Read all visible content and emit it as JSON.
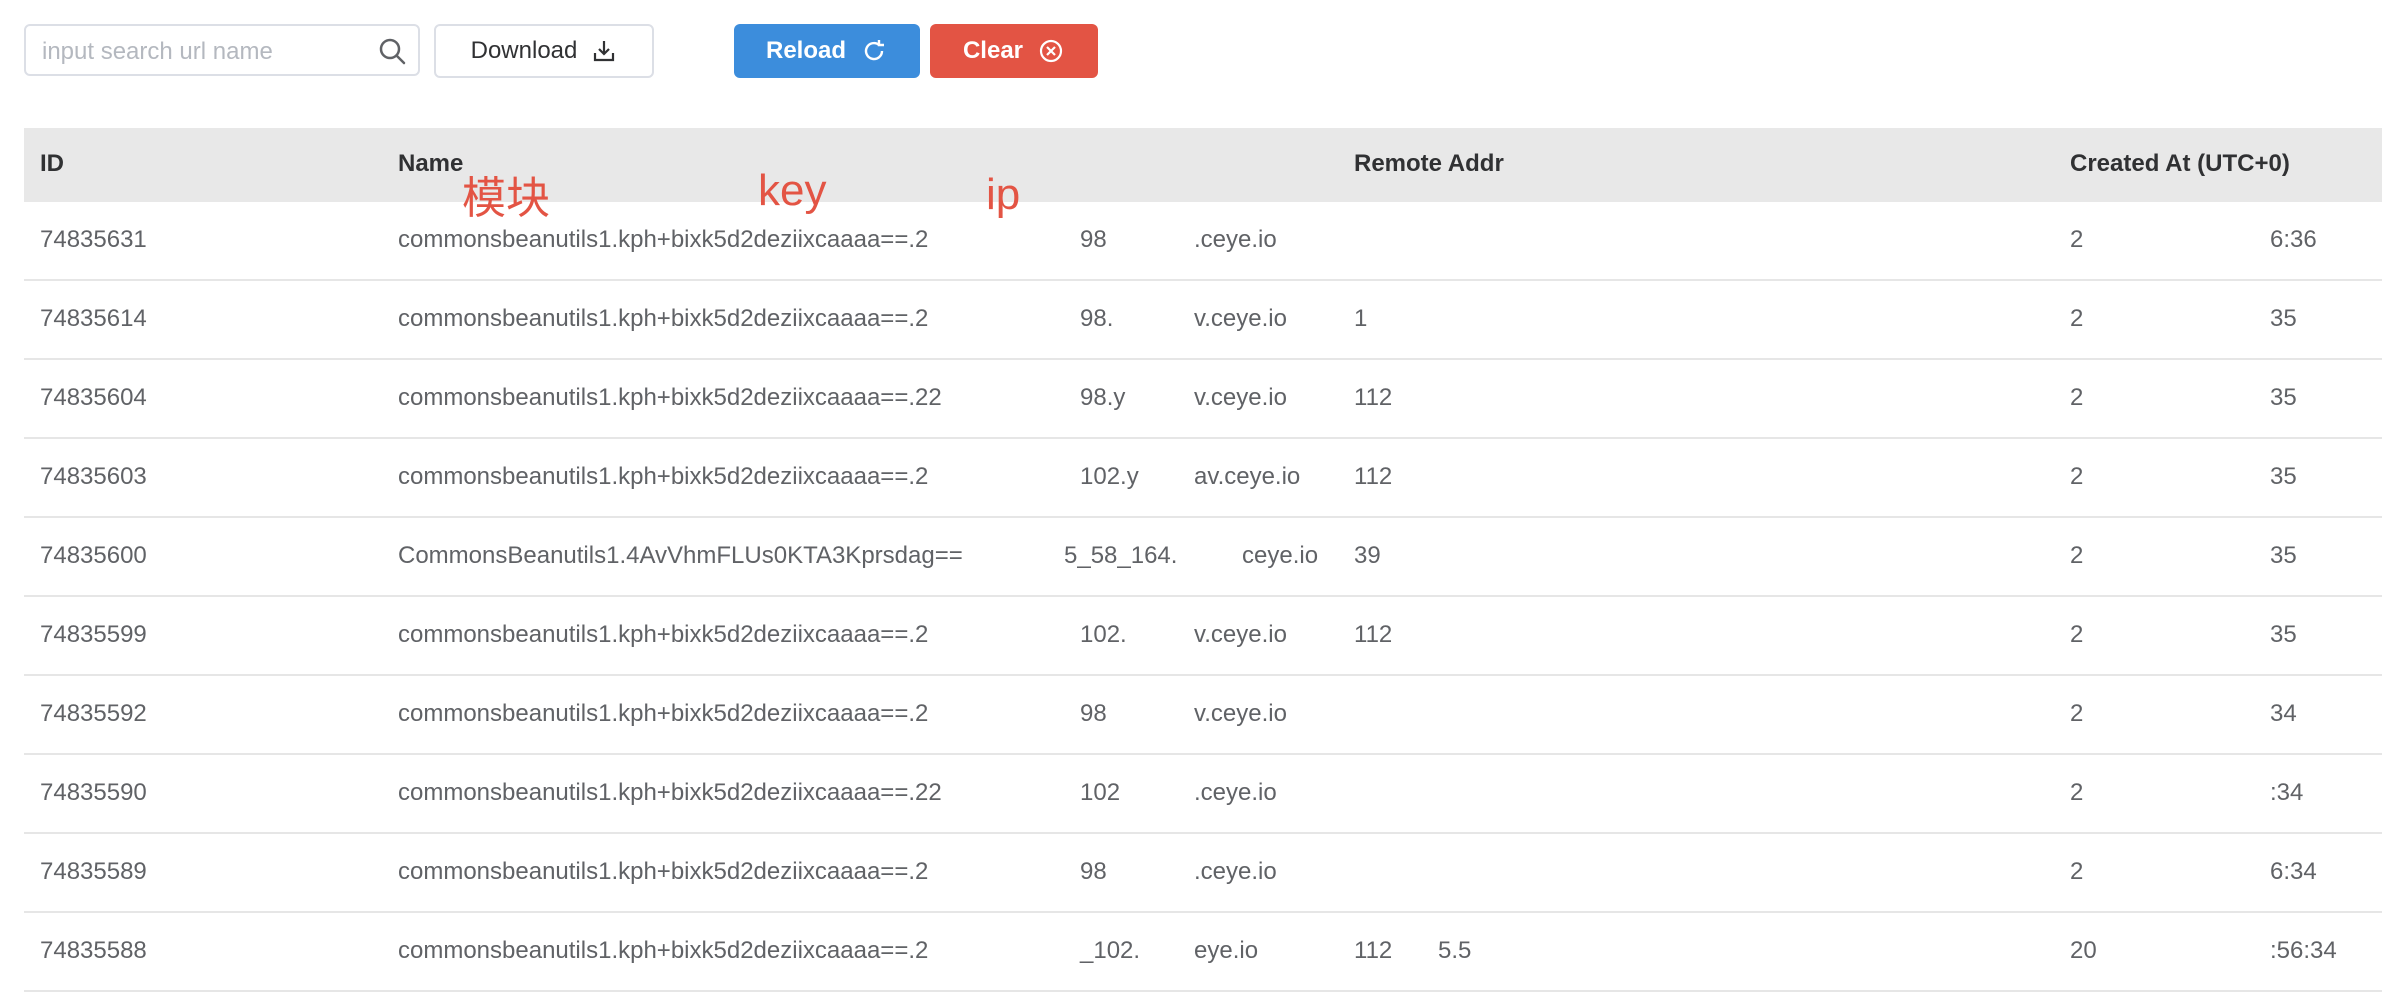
{
  "toolbar": {
    "search_placeholder": "input search url name",
    "download_label": "Download",
    "reload_label": "Reload",
    "clear_label": "Clear"
  },
  "table": {
    "headers": {
      "id": "ID",
      "name": "Name",
      "remote_addr": "Remote Addr",
      "created_at": "Created At (UTC+0)"
    },
    "rows": [
      {
        "id": "74835631",
        "name": "commonsbeanutils1.kph+bixk5d2deziixcaaaa==.2",
        "name_tail": "98",
        "name_suffix": ".ceye.io",
        "addr": "",
        "created": "2",
        "created_tail": "6:36"
      },
      {
        "id": "74835614",
        "name": "commonsbeanutils1.kph+bixk5d2deziixcaaaa==.2",
        "name_tail": "98.",
        "name_suffix": "v.ceye.io",
        "addr": "1",
        "created": "2",
        "created_tail": "35"
      },
      {
        "id": "74835604",
        "name": "commonsbeanutils1.kph+bixk5d2deziixcaaaa==.22",
        "name_tail": "98.y",
        "name_suffix": "v.ceye.io",
        "addr": "112",
        "created": "2",
        "created_tail": "35"
      },
      {
        "id": "74835603",
        "name": "commonsbeanutils1.kph+bixk5d2deziixcaaaa==.2",
        "name_tail": "102.y",
        "name_suffix": "av.ceye.io",
        "addr": "112",
        "created": "2",
        "created_tail": "35"
      },
      {
        "id": "74835600",
        "name": "CommonsBeanutils1.4AvVhmFLUs0KTA3Kprsdag==",
        "name_tail": "5_58_164.",
        "name_suffix": "ceye.io",
        "addr": "39",
        "created": "2",
        "created_tail": "35"
      },
      {
        "id": "74835599",
        "name": "commonsbeanutils1.kph+bixk5d2deziixcaaaa==.2",
        "name_tail": "102.",
        "name_suffix": "v.ceye.io",
        "addr": "112",
        "created": "2",
        "created_tail": "35"
      },
      {
        "id": "74835592",
        "name": "commonsbeanutils1.kph+bixk5d2deziixcaaaa==.2",
        "name_tail": "98",
        "name_suffix": "v.ceye.io",
        "addr": "",
        "created": "2",
        "created_tail": "34"
      },
      {
        "id": "74835590",
        "name": "commonsbeanutils1.kph+bixk5d2deziixcaaaa==.22",
        "name_tail": "102",
        "name_suffix": ".ceye.io",
        "addr": "",
        "created": "2",
        "created_tail": ":34"
      },
      {
        "id": "74835589",
        "name": "commonsbeanutils1.kph+bixk5d2deziixcaaaa==.2",
        "name_tail": "98",
        "name_suffix": ".ceye.io",
        "addr": "",
        "created": "2",
        "created_tail": "6:34"
      },
      {
        "id": "74835588",
        "name": "commonsbeanutils1.kph+bixk5d2deziixcaaaa==.2",
        "name_tail": "_102.",
        "name_suffix": "eye.io",
        "addr": "112",
        "addr_tail": "5.5",
        "created": "20",
        "created_tail": ":56:34"
      }
    ]
  },
  "annotations": {
    "module": "模块",
    "key": "key",
    "ip": "ip"
  },
  "colors": {
    "reload_bg": "#3c8ddc",
    "clear_bg": "#e35444",
    "annotation": "#e35444",
    "header_bg": "#e8e8e8"
  },
  "icons": {
    "search": "search-icon",
    "download": "download-icon",
    "reload": "refresh-icon",
    "clear": "close-circle-icon"
  }
}
